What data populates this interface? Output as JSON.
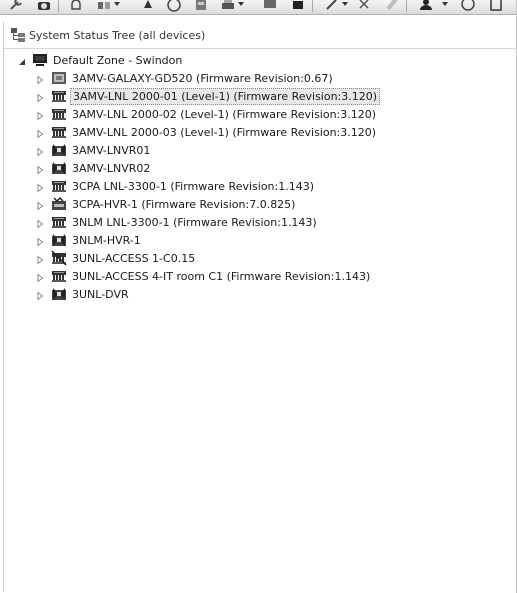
{
  "panel": {
    "title": "System Status Tree (all devices)"
  },
  "tree": {
    "root": {
      "label": "Default Zone - Swindon",
      "icon": "workstation-icon"
    },
    "children": [
      {
        "label": "3AMV-GALAXY-GD520 (Firmware Revision:0.67)",
        "icon": "panel-device-icon"
      },
      {
        "label": "3AMV-LNL 2000-01 (Level-1) (Firmware Revision:3.120)",
        "icon": "access-controller-icon",
        "selected": true
      },
      {
        "label": "3AMV-LNL 2000-02 (Level-1) (Firmware Revision:3.120)",
        "icon": "access-controller-icon"
      },
      {
        "label": "3AMV-LNL 2000-03 (Level-1) (Firmware Revision:3.120)",
        "icon": "access-controller-icon"
      },
      {
        "label": "3AMV-LNVR01",
        "icon": "video-recorder-icon"
      },
      {
        "label": "3AMV-LNVR02",
        "icon": "video-recorder-icon"
      },
      {
        "label": "3CPA LNL-3300-1 (Firmware Revision:1.143)",
        "icon": "access-controller-icon"
      },
      {
        "label": "3CPA-HVR-1 (Firmware Revision:7.0.825)",
        "icon": "hvr-icon"
      },
      {
        "label": "3NLM LNL-3300-1 (Firmware Revision:1.143)",
        "icon": "access-controller-icon"
      },
      {
        "label": "3NLM-HVR-1",
        "icon": "video-recorder-icon"
      },
      {
        "label": "3UNL-ACCESS 1-C0.15",
        "icon": "access-controller-offline-icon"
      },
      {
        "label": "3UNL-ACCESS 4-IT room C1 (Firmware Revision:1.143)",
        "icon": "access-controller-icon"
      },
      {
        "label": "3UNL-DVR",
        "icon": "video-recorder-icon"
      }
    ]
  },
  "colors": {
    "background": "#ffffff",
    "selection": "#e8e8e8",
    "text": "#1a1a1a"
  }
}
